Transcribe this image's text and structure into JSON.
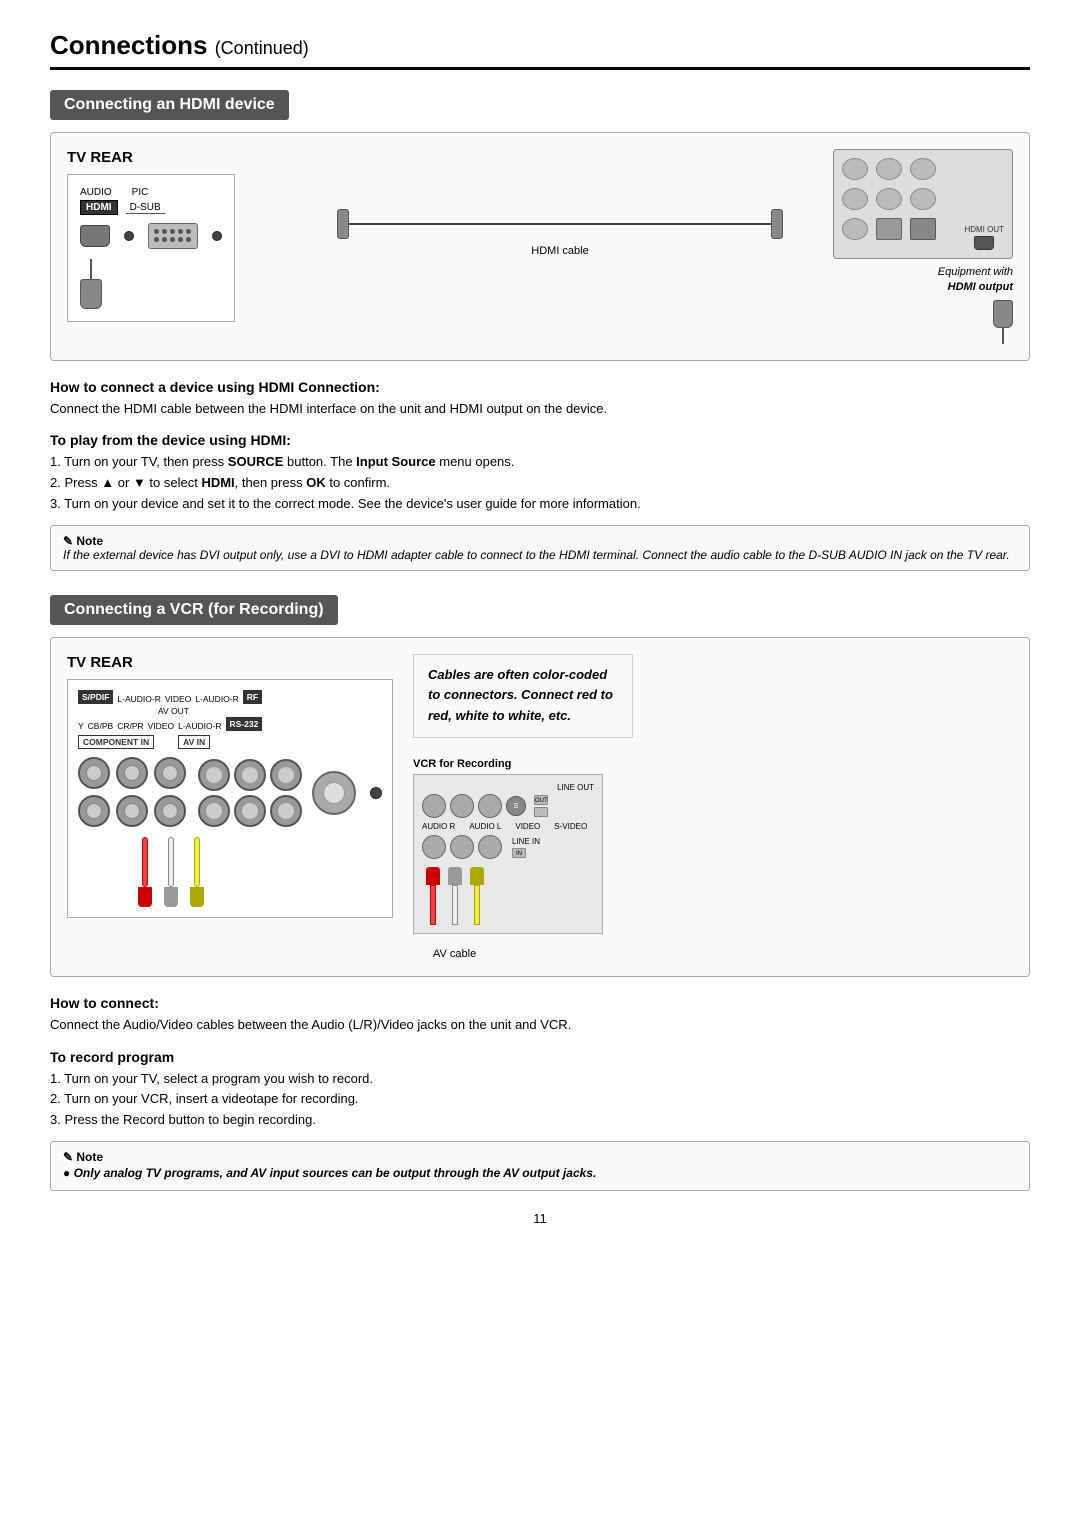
{
  "page": {
    "title": "Connections",
    "title_continued": "(Continued)",
    "page_number": "11"
  },
  "hdmi_section": {
    "header": "Connecting an HDMI device",
    "diagram": {
      "tv_rear_label": "TV REAR",
      "audio_label": "AUDIO",
      "pic_label": "PIC",
      "hdmi_label": "HDMI",
      "dsub_label": "D-SUB",
      "cable_label": "HDMI cable",
      "equipment_label": "Equipment with",
      "hdmi_output_label": "HDMI output"
    },
    "how_to_connect_title": "How to connect a device using HDMI Connection:",
    "how_to_connect_text": "Connect the HDMI cable between the HDMI interface on the unit and HDMI output on the device.",
    "play_title": "To play from the device using HDMI:",
    "play_steps": [
      "1. Turn on your TV,  then press SOURCE button. The Input Source menu opens.",
      "2. Press ▲ or ▼ to select HDMI, then press OK to confirm.",
      "3. Turn on your device and set it to the correct mode. See the device's user guide for more information."
    ],
    "note_text": "If the external device has DVI output only, use a DVI to HDMI adapter cable to connect to the HDMI terminal. Connect the audio cable to the D-SUB AUDIO IN jack on the TV rear."
  },
  "vcr_section": {
    "header": "Connecting a VCR (for Recording)",
    "diagram": {
      "tv_rear_label": "TV REAR",
      "spdif_label": "S/PDIF",
      "audio_r_label": "L-AUDIO-R",
      "video_label": "VIDEO",
      "rf_label": "RF",
      "av_out_label": "AV OUT",
      "y_label": "Y",
      "cb_label": "CB/PB",
      "cr_label": "CR/PR",
      "component_in_label": "COMPONENT IN",
      "av_in_label": "AV IN",
      "rs232_label": "RS-232",
      "cable_label": "AV cable",
      "colored_text": "Cables are often color-coded to connectors. Connect red to red, white to white, etc.",
      "vcr_label": "VCR for Recording",
      "line_out_label": "LINE OUT",
      "audio_r_vcr": "AUDIO R",
      "audio_l_vcr": "AUDIO L",
      "video_vcr": "VIDEO",
      "svideo_vcr": "S-VIDEO",
      "line_in_label": "LINE IN"
    },
    "how_to_connect_title": "How to connect:",
    "how_to_connect_text": "Connect the Audio/Video cables between the Audio (L/R)/Video jacks on the unit and VCR.",
    "record_title": "To record program",
    "record_steps": [
      "1. Turn on your TV, select a program you wish to record.",
      "2. Turn on your VCR, insert a videotape for recording.",
      "3. Press the Record button to begin recording."
    ],
    "note_text": "● Only analog TV programs, and AV input sources can be output through the AV output jacks."
  }
}
